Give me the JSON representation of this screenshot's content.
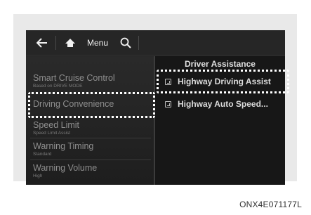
{
  "topbar": {
    "back_icon": "back-arrow-icon",
    "home_icon": "home-icon",
    "menu_label": "Menu",
    "search_icon": "search-icon"
  },
  "left_menu": {
    "items": [
      {
        "title": "Smart Cruise Control",
        "subtitle": "Based on DRIVE MODE"
      },
      {
        "title": "Driving Convenience",
        "subtitle": ""
      },
      {
        "title": "Speed Limit",
        "subtitle": "Speed Limit Assist"
      },
      {
        "title": "Warning Timing",
        "subtitle": "Standard"
      },
      {
        "title": "Warning Volume",
        "subtitle": "High"
      }
    ]
  },
  "right_panel": {
    "title": "Driver Assistance",
    "options": [
      {
        "label": "Highway Driving Assist",
        "checked": true
      },
      {
        "label": "Highway Auto Speed...",
        "checked": true
      }
    ]
  },
  "caption": "ONX4E071177L"
}
